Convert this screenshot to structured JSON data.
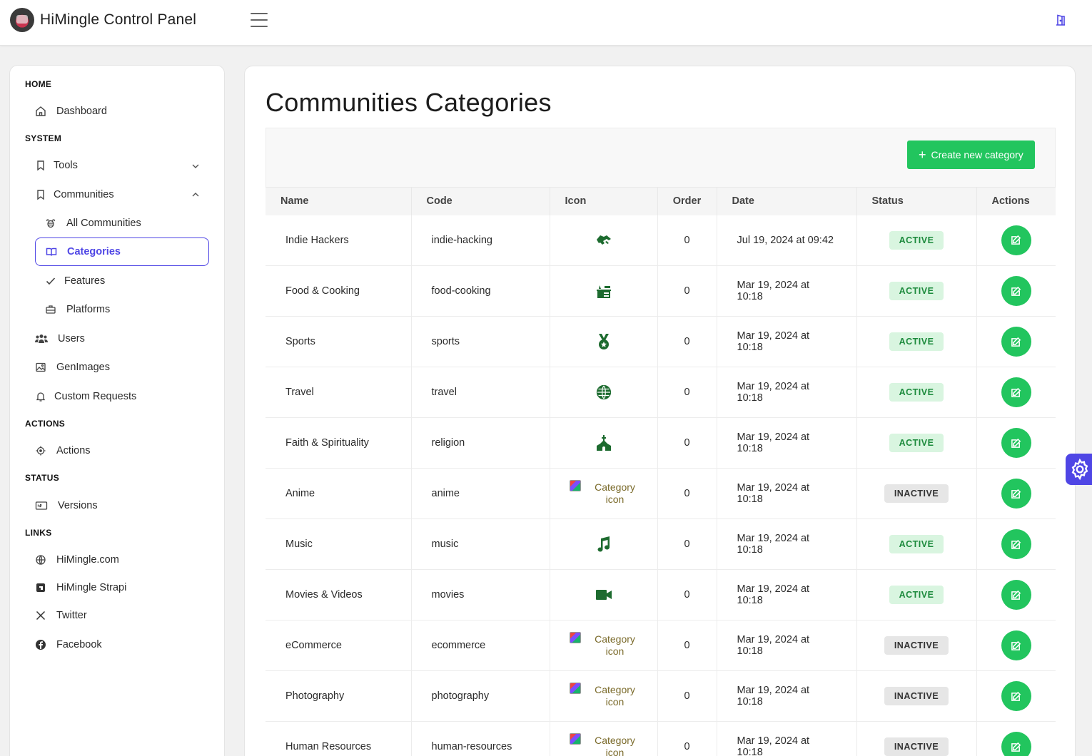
{
  "app": {
    "title": "HiMingle Control Panel"
  },
  "sidebar": {
    "sections": {
      "home": "HOME",
      "system": "SYSTEM",
      "actions": "ACTIONS",
      "status": "STATUS",
      "links": "LINKS"
    },
    "items": {
      "dashboard": "Dashboard",
      "tools": "Tools",
      "communities": "Communities",
      "all_communities": "All Communities",
      "categories": "Categories",
      "features": "Features",
      "platforms": "Platforms",
      "users": "Users",
      "genimages": "GenImages",
      "custom_requests": "Custom Requests",
      "actions": "Actions",
      "versions": "Versions",
      "himingle_com": "HiMingle.com",
      "himingle_strapi": "HiMingle Strapi",
      "twitter": "Twitter",
      "facebook": "Facebook"
    }
  },
  "main": {
    "title": "Communities Categories",
    "create_button": "Create new category",
    "columns": [
      "Name",
      "Code",
      "Icon",
      "Order",
      "Date",
      "Status",
      "Actions"
    ],
    "rows": [
      {
        "name": "Indie Hackers",
        "code": "indie-hacking",
        "icon": "handshake-icon",
        "order": "0",
        "date": "Jul 19, 2024 at 09:42",
        "status": "ACTIVE"
      },
      {
        "name": "Food & Cooking",
        "code": "food-cooking",
        "icon": "kitchen-icon",
        "order": "0",
        "date": "Mar 19, 2024 at 10:18",
        "status": "ACTIVE"
      },
      {
        "name": "Sports",
        "code": "sports",
        "icon": "medal-icon",
        "order": "0",
        "date": "Mar 19, 2024 at 10:18",
        "status": "ACTIVE"
      },
      {
        "name": "Travel",
        "code": "travel",
        "icon": "globe-icon",
        "order": "0",
        "date": "Mar 19, 2024 at 10:18",
        "status": "ACTIVE"
      },
      {
        "name": "Faith & Spirituality",
        "code": "religion",
        "icon": "church-icon",
        "order": "0",
        "date": "Mar 19, 2024 at 10:18",
        "status": "ACTIVE"
      },
      {
        "name": "Anime",
        "code": "anime",
        "icon": "broken-image",
        "icon_alt": "Category icon",
        "order": "0",
        "date": "Mar 19, 2024 at 10:18",
        "status": "INACTIVE"
      },
      {
        "name": "Music",
        "code": "music",
        "icon": "music-note-icon",
        "order": "0",
        "date": "Mar 19, 2024 at 10:18",
        "status": "ACTIVE"
      },
      {
        "name": "Movies & Videos",
        "code": "movies",
        "icon": "video-camera-icon",
        "order": "0",
        "date": "Mar 19, 2024 at 10:18",
        "status": "ACTIVE"
      },
      {
        "name": "eCommerce",
        "code": "ecommerce",
        "icon": "broken-image",
        "icon_alt": "Category icon",
        "order": "0",
        "date": "Mar 19, 2024 at 10:18",
        "status": "INACTIVE"
      },
      {
        "name": "Photography",
        "code": "photography",
        "icon": "broken-image",
        "icon_alt": "Category icon",
        "order": "0",
        "date": "Mar 19, 2024 at 10:18",
        "status": "INACTIVE"
      },
      {
        "name": "Human Resources",
        "code": "human-resources",
        "icon": "broken-image",
        "icon_alt": "Category icon",
        "order": "0",
        "date": "Mar 19, 2024 at 10:18",
        "status": "INACTIVE"
      }
    ]
  },
  "colors": {
    "accent": "#4f46e5",
    "success": "#22c55e",
    "icon_green": "#1d6b2f"
  }
}
